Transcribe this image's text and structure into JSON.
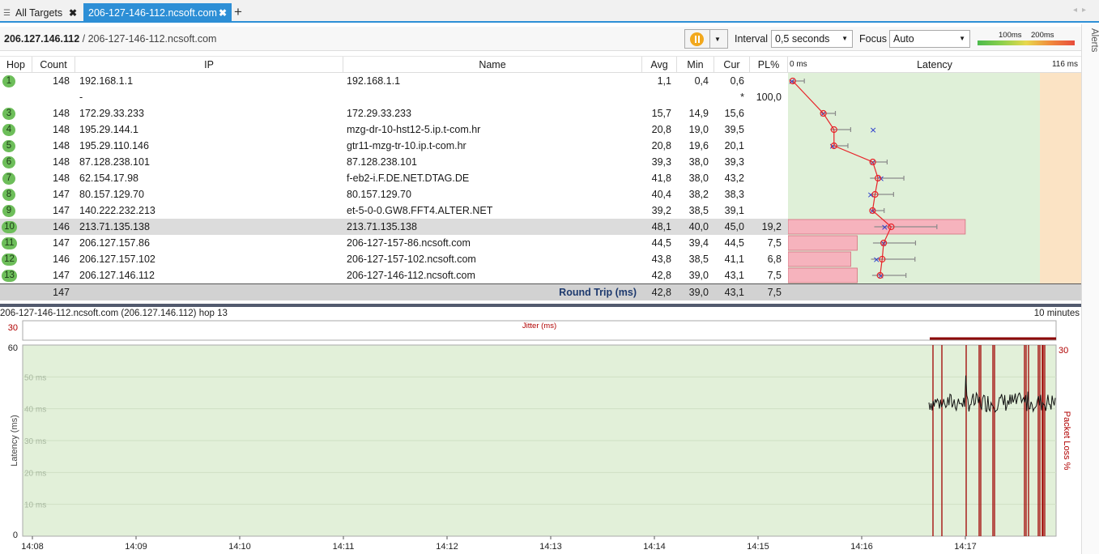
{
  "tabs": {
    "all_targets": "All Targets",
    "active": "206-127-146-112.ncsoft.com",
    "close": "✖",
    "add": "+"
  },
  "header": {
    "target_ip": "206.127.146.112",
    "target_host": "206-127-146-112.ncsoft.com",
    "interval_label": "Interval",
    "interval_value": "0,5 seconds",
    "focus_label": "Focus",
    "focus_value": "Auto",
    "legend_100": "100ms",
    "legend_200": "200ms",
    "alerts": "Alerts"
  },
  "columns": {
    "hop": "Hop",
    "count": "Count",
    "ip": "IP",
    "name": "Name",
    "avg": "Avg",
    "min": "Min",
    "cur": "Cur",
    "pl": "PL%",
    "latency": "Latency",
    "latency_min": "0 ms",
    "latency_max": "116 ms"
  },
  "hops": [
    {
      "hop": "1",
      "count": "148",
      "ip": "192.168.1.1",
      "name": "192.168.1.1",
      "avg": "1,1",
      "min": "0,4",
      "cur": "0,6",
      "pl": ""
    },
    {
      "hop": "",
      "count": "",
      "ip": "-",
      "name": "",
      "avg": "",
      "min": "",
      "cur": "*",
      "pl": "100,0"
    },
    {
      "hop": "3",
      "count": "148",
      "ip": "172.29.33.233",
      "name": "172.29.33.233",
      "avg": "15,7",
      "min": "14,9",
      "cur": "15,6",
      "pl": ""
    },
    {
      "hop": "4",
      "count": "148",
      "ip": "195.29.144.1",
      "name": "mzg-dr-10-hst12-5.ip.t-com.hr",
      "avg": "20,8",
      "min": "19,0",
      "cur": "39,5",
      "pl": ""
    },
    {
      "hop": "5",
      "count": "148",
      "ip": "195.29.110.146",
      "name": "gtr11-mzg-tr-10.ip.t-com.hr",
      "avg": "20,8",
      "min": "19,6",
      "cur": "20,1",
      "pl": ""
    },
    {
      "hop": "6",
      "count": "148",
      "ip": "87.128.238.101",
      "name": "87.128.238.101",
      "avg": "39,3",
      "min": "38,0",
      "cur": "39,3",
      "pl": ""
    },
    {
      "hop": "7",
      "count": "148",
      "ip": "62.154.17.98",
      "name": "f-eb2-i.F.DE.NET.DTAG.DE",
      "avg": "41,8",
      "min": "38,0",
      "cur": "43,2",
      "pl": ""
    },
    {
      "hop": "8",
      "count": "147",
      "ip": "80.157.129.70",
      "name": "80.157.129.70",
      "avg": "40,4",
      "min": "38,2",
      "cur": "38,3",
      "pl": ""
    },
    {
      "hop": "9",
      "count": "147",
      "ip": "140.222.232.213",
      "name": "et-5-0-0.GW8.FFT4.ALTER.NET",
      "avg": "39,2",
      "min": "38,5",
      "cur": "39,1",
      "pl": ""
    },
    {
      "hop": "10",
      "count": "146",
      "ip": "213.71.135.138",
      "name": "213.71.135.138",
      "avg": "48,1",
      "min": "40,0",
      "cur": "45,0",
      "pl": "19,2"
    },
    {
      "hop": "11",
      "count": "147",
      "ip": "206.127.157.86",
      "name": "206-127-157-86.ncsoft.com",
      "avg": "44,5",
      "min": "39,4",
      "cur": "44,5",
      "pl": "7,5"
    },
    {
      "hop": "12",
      "count": "146",
      "ip": "206.127.157.102",
      "name": "206-127-157-102.ncsoft.com",
      "avg": "43,8",
      "min": "38,5",
      "cur": "41,1",
      "pl": "6,8"
    },
    {
      "hop": "13",
      "count": "147",
      "ip": "206.127.146.112",
      "name": "206-127-146-112.ncsoft.com",
      "avg": "42,8",
      "min": "39,0",
      "cur": "43,1",
      "pl": "7,5"
    }
  ],
  "totals": {
    "count": "147",
    "label": "Round Trip (ms)",
    "avg": "42,8",
    "min": "39,0",
    "cur": "43,1",
    "pl": "7,5"
  },
  "bottom": {
    "title": "206-127-146-112.ncsoft.com (206.127.146.112) hop 13",
    "range": "10 minutes",
    "jitter_label": "Jitter (ms)",
    "jitter_max": "30",
    "y_label": "Latency (ms)",
    "y2_label": "Packet Loss %",
    "y_max": "60",
    "y_min": "0",
    "y2_max": "30",
    "y_ticks": [
      "50 ms",
      "40 ms",
      "30 ms",
      "20 ms",
      "10 ms"
    ],
    "x_ticks": [
      "14:08",
      "14:09",
      "14:10",
      "14:11",
      "14:12",
      "14:13",
      "14:14",
      "14:15",
      "14:16",
      "14:17"
    ]
  },
  "chart_data": {
    "type": "line",
    "title": "Latency",
    "xlabel": "",
    "ylabel": "Latency (ms)",
    "ylim": [
      0,
      60
    ],
    "x_range": [
      "14:08",
      "14:17"
    ],
    "series": [
      {
        "name": "Latency",
        "note": "active only after ~14:16:40",
        "approx_range_ms": [
          39,
          46
        ]
      }
    ],
    "packet_loss_markers": 15,
    "colors": {
      "graph_bg": "#e2f0d9",
      "line": "#111111",
      "loss": "#a00000"
    }
  },
  "colors": {
    "accent": "#2d8fd6",
    "hop_badge": "#6dbe5a",
    "latency_green": "#dff0d8",
    "latency_orange": "#fbe3c4",
    "loss_bar": "#f6b3bd"
  }
}
